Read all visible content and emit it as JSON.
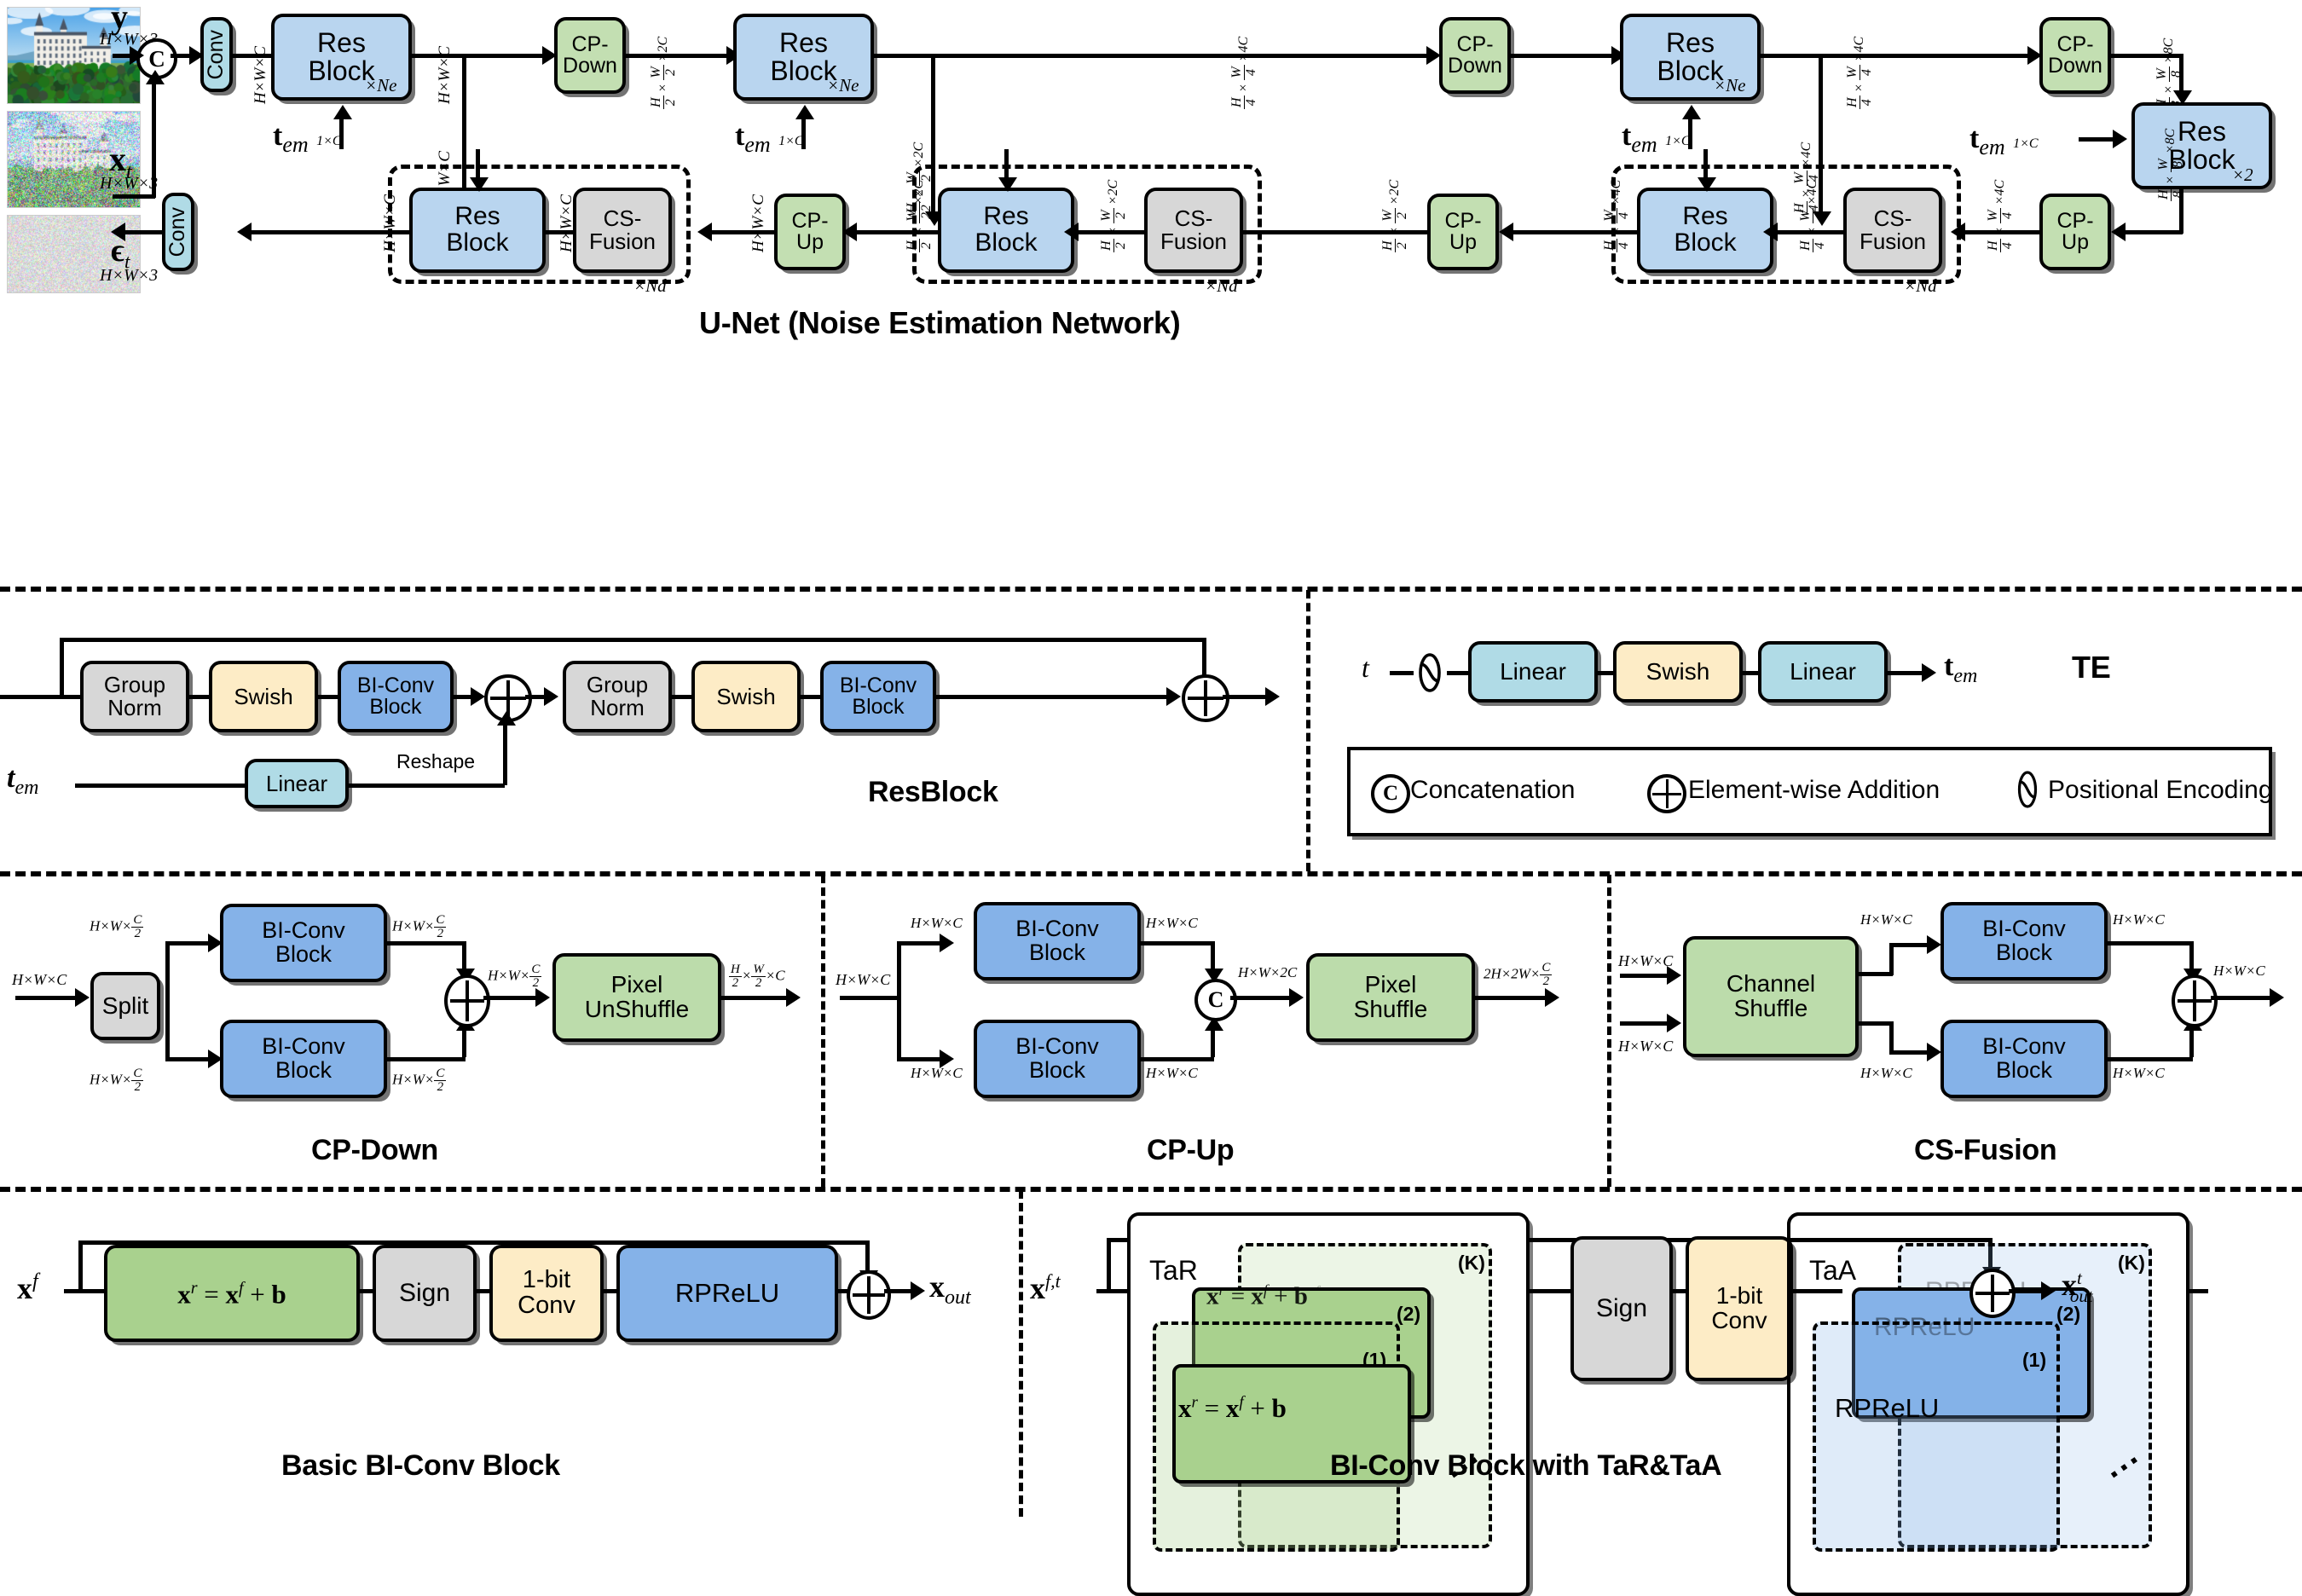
{
  "figure": {
    "sections": [
      {
        "id": "unet",
        "title": "U-Net (Noise Estimation Network)"
      },
      {
        "id": "resblock",
        "title": "ResBlock"
      },
      {
        "id": "te",
        "title": "TE"
      },
      {
        "id": "cpdown",
        "title": "CP-Down"
      },
      {
        "id": "cpup",
        "title": "CP-Up"
      },
      {
        "id": "csfusion",
        "title": "CS-Fusion"
      },
      {
        "id": "basicbi",
        "title": "Basic BI-Conv Block"
      },
      {
        "id": "bitartaa",
        "title": "BI-Conv Block with TaR&TaA"
      }
    ]
  },
  "unet": {
    "title": "U-Net (Noise Estimation Network)",
    "inputs": {
      "clean_label": "y",
      "clean_dims": "H×W×3",
      "noisy_label": "x",
      "noisy_sub": "t",
      "noisy_dims": "H×W×3",
      "output_label": "ϵ",
      "output_sub": "t",
      "output_dims": "H×W×3"
    },
    "concat_icon": "concatenation-icon",
    "encoder": {
      "conv_in": "Conv",
      "resblocks": [
        {
          "label_line1": "Res",
          "label_line2": "Block",
          "repeat": "×Ne"
        },
        {
          "label_line1": "Res",
          "label_line2": "Block",
          "repeat": "×Ne"
        },
        {
          "label_line1": "Res",
          "label_line2": "Block",
          "repeat": "×Ne"
        }
      ],
      "downsamplers": [
        {
          "line1": "CP-",
          "line2": "Down"
        },
        {
          "line1": "CP-",
          "line2": "Down"
        },
        {
          "line1": "CP-",
          "line2": "Down"
        }
      ]
    },
    "bottleneck": {
      "line1": "Res",
      "line2": "Block",
      "repeat": "×2"
    },
    "decoder": {
      "conv_out": "Conv",
      "resblocks": [
        {
          "label_line1": "Res",
          "label_line2": "Block"
        },
        {
          "label_line1": "Res",
          "label_line2": "Block"
        },
        {
          "label_line1": "Res",
          "label_line2": "Block"
        }
      ],
      "fusions": [
        {
          "line1": "CS-",
          "line2": "Fusion"
        },
        {
          "line1": "CS-",
          "line2": "Fusion"
        },
        {
          "line1": "CS-",
          "line2": "Fusion"
        }
      ],
      "upsamplers": [
        {
          "line1": "CP-",
          "line2": "Up"
        },
        {
          "line1": "CP-",
          "line2": "Up"
        },
        {
          "line1": "CP-",
          "line2": "Up"
        },
        {
          "line1": "CP-",
          "line2": "Up"
        }
      ],
      "stage_repeat": "×Nd"
    },
    "time_embed_label": "t",
    "time_embed_sub": "em",
    "time_embed_dims": "1×C",
    "dims": {
      "after_conv": "H×W×C",
      "enc1_out": "H×W×C",
      "skip1": "H×W×C",
      "enc2_in": "H/2 × W/2 × 2C",
      "enc2_skip": "H/2 × W/2 × 2C",
      "enc3_in": "H/4 × W/4 × 4C",
      "enc3_skip": "H/4 × W/4 × 4C",
      "bottleneck_in": "H/8 × W/8 × 8C",
      "bottleneck_out": "H/8 × W/8 × 8C",
      "dec3": "H/4 × W/4 × 4C",
      "dec2": "H/2 × W/2 × 2C",
      "dec1": "H×W×C",
      "dec_out": "H×W×C"
    }
  },
  "resblock": {
    "title": "ResBlock",
    "input_label": "t",
    "input_sub": "em",
    "reshape_label": "Reshape",
    "nodes": [
      {
        "line1": "Group",
        "line2": "Norm"
      },
      {
        "line1": "Swish",
        "line2": ""
      },
      {
        "line1": "BI-Conv",
        "line2": "Block"
      },
      {
        "line1": "Group",
        "line2": "Norm"
      },
      {
        "line1": "Swish",
        "line2": ""
      },
      {
        "line1": "BI-Conv",
        "line2": "Block"
      }
    ],
    "linear_label": "Linear"
  },
  "te": {
    "title": "TE",
    "input_label": "t",
    "output_label": "t",
    "output_sub": "em",
    "pe_icon": "positional-encoding-icon",
    "nodes": [
      {
        "label": "Linear"
      },
      {
        "label": "Swish"
      },
      {
        "label": "Linear"
      }
    ]
  },
  "legend": {
    "items": [
      {
        "icon": "concatenation-icon",
        "label": "Concatenation"
      },
      {
        "icon": "element-wise-addition-icon",
        "label": "Element-wise Addition"
      },
      {
        "icon": "positional-encoding-icon",
        "label": "Positional Encoding"
      }
    ]
  },
  "cpdown": {
    "title": "CP-Down",
    "split_label": "Split",
    "biconv": {
      "line1": "BI-Conv",
      "line2": "Block"
    },
    "pixel": {
      "line1": "Pixel",
      "line2": "UnShuffle"
    },
    "dims": {
      "in": "H×W×C",
      "branch_in_top": "H×W×C/2",
      "branch_in_bot": "H×W×C/2",
      "branch_out_top": "H×W×C/2",
      "branch_out_bot": "H×W×C/2",
      "after_add": "H×W×C/2",
      "out": "H/2 × W/2 × C"
    }
  },
  "cpup": {
    "title": "CP-Up",
    "biconv": {
      "line1": "BI-Conv",
      "line2": "Block"
    },
    "pixel": {
      "line1": "Pixel",
      "line2": "Shuffle"
    },
    "concat_icon": "concatenation-icon",
    "dims": {
      "in": "H×W×C",
      "branch_in_top": "H×W×C",
      "branch_in_bot": "H×W×C",
      "branch_out_top": "H×W×C",
      "branch_out_bot": "H×W×C",
      "after_concat": "H×W×2C",
      "out": "2H×2W×C/2"
    }
  },
  "csfusion": {
    "title": "CS-Fusion",
    "shuffle": {
      "line1": "Channel",
      "line2": "Shuffle"
    },
    "biconv": {
      "line1": "BI-Conv",
      "line2": "Block"
    },
    "dims": {
      "in_top": "H×W×C",
      "in_bot": "H×W×C",
      "branch_in_top": "H×W×C",
      "branch_in_bot": "H×W×C",
      "branch_out_top": "H×W×C",
      "branch_out_bot": "H×W×C",
      "out": "H×W×C"
    }
  },
  "basicbi": {
    "title": "Basic BI-Conv Block",
    "input_label": "x",
    "input_sup": "f",
    "output_label": "x",
    "output_sub": "out",
    "nodes": [
      {
        "label": "xr = xf + b",
        "kind": "equation"
      },
      {
        "label": "Sign",
        "kind": "plain"
      },
      {
        "line1": "1-bit",
        "line2": "Conv",
        "kind": "plain"
      },
      {
        "label": "RPReLU",
        "kind": "plain"
      }
    ]
  },
  "bitartaa": {
    "title": "BI-Conv Block with TaR&TaA",
    "input_label": "x",
    "input_sup": "f,t",
    "output_label": "x",
    "output_sup": "t",
    "output_sub": "out",
    "tar_label": "TaR",
    "taa_label": "TaA",
    "equation": "xr = xf + b",
    "rprelu_label": "RPReLU",
    "indices": [
      "(1)",
      "(2)",
      "(K)"
    ],
    "sign_label": "Sign",
    "conv": {
      "line1": "1-bit",
      "line2": "Conv"
    },
    "ellipsis": "..."
  },
  "colors": {
    "blue_block": "#b9d5ef",
    "blue_biconv": "#85b2e8",
    "green_block": "#c3dfb2",
    "cyan_block": "#b0dbe6",
    "gray_block": "#d7d7d7",
    "cream_block": "#fdecc6",
    "outline": "#000000",
    "background": "#ffffff"
  }
}
